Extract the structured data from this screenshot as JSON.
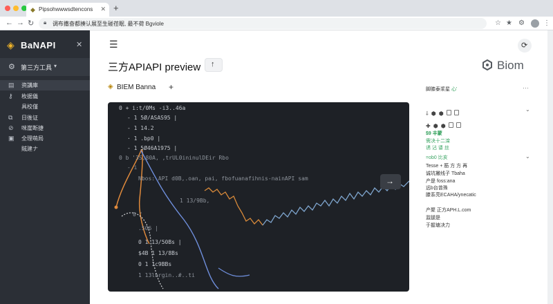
{
  "browser": {
    "tab_title": "Pipsohwwwsdtencons",
    "url": "调布撒奋都揍认展至生碰荏眠, 最不荷 Bgviole"
  },
  "sidebar": {
    "brand": "BaNAPI",
    "workspace": "第三方工具",
    "items": [
      {
        "label": "资講庫"
      },
      {
        "label": "枚据儀"
      },
      {
        "label": "具校僅"
      },
      {
        "label": "日後证"
      },
      {
        "label": "咪崖断捷"
      },
      {
        "label": "全理萌局"
      },
      {
        "label": "賊建ナ"
      }
    ]
  },
  "header": {
    "title": "三方APIAPI preview",
    "logo": "Biom"
  },
  "section": {
    "title": "BIEM Banna"
  },
  "preview": {
    "lines": [
      "0 + i:t/0Ms -i3..46a",
      "-  1 5Ø/ASAS95 |",
      "-  1 14.2",
      "·  1 .bp0 |",
      "-  1 5Ø46A1975 |",
      "0  b '3S,80A, ,trUL0ininulDEir Rbo",
      "- i",
      "Nbos: API d0B,.oan, pai, fbofuanafihnis-nainAPI sam",
      "1 13/9Bb,",
      "0 '",
      ".506 |",
      "0      1 13/50Bs |",
      "$4B     1 13/8Bs",
      "0        1 1c9BBs",
      "         1 13lbrgin..#..ti"
    ]
  },
  "right_panel": {
    "header_a": "脚膝泰浆星 ",
    "header_b": "心'",
    "status": "$9 丰蒙",
    "sub1": "需决十二滦",
    "sub2": "诱 沾 诿 丝",
    "items": [
      "=ob0 比亥",
      "Tesse + 筋 方 方 再",
      "诚坑撇线子 Tbaha",
      "产是 foss:ana",
      "远b台曾殊",
      "滕系亮ECAHA/ynecatic",
      "产聚 正方APH.L.com",
      "监腿是",
      "于握塘决力"
    ]
  }
}
